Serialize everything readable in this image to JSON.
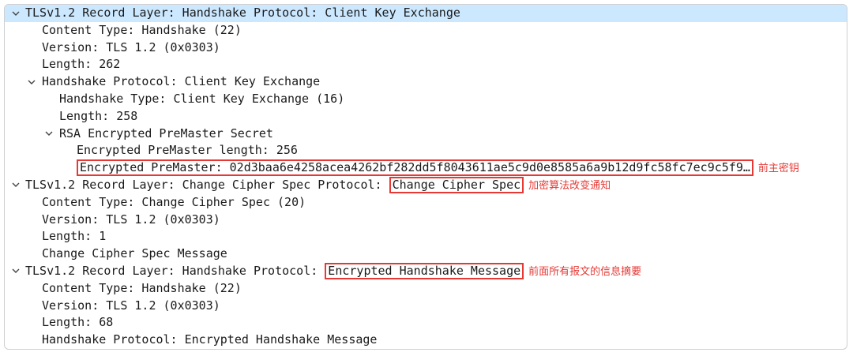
{
  "tree": {
    "rows": [
      {
        "text": "TLSv1.2 Record Layer: Handshake Protocol: Client Key Exchange"
      },
      {
        "text": "Content Type: Handshake (22)"
      },
      {
        "text": "Version: TLS 1.2 (0x0303)"
      },
      {
        "text": "Length: 262"
      },
      {
        "text": "Handshake Protocol: Client Key Exchange"
      },
      {
        "text": "Handshake Type: Client Key Exchange (16)"
      },
      {
        "text": "Length: 258"
      },
      {
        "text": "RSA Encrypted PreMaster Secret"
      },
      {
        "text": "Encrypted PreMaster length: 256"
      },
      {
        "text": "Encrypted PreMaster: 02d3baa6e4258acea4262bf282dd5f8043611ae5c9d0e8585a6a9b12d9fc58fc7ec9c5f9…",
        "note": "前主密钥"
      },
      {
        "prefix": "TLSv1.2 Record Layer: Change Cipher Spec Protocol: ",
        "boxed": "Change Cipher Spec",
        "note": "加密算法改变通知"
      },
      {
        "text": "Content Type: Change Cipher Spec (20)"
      },
      {
        "text": "Version: TLS 1.2 (0x0303)"
      },
      {
        "text": "Length: 1"
      },
      {
        "text": "Change Cipher Spec Message"
      },
      {
        "prefix": "TLSv1.2 Record Layer: Handshake Protocol: ",
        "boxed": "Encrypted Handshake Message",
        "note": "前面所有报文的信息摘要"
      },
      {
        "text": "Content Type: Handshake (22)"
      },
      {
        "text": "Version: TLS 1.2 (0x0303)"
      },
      {
        "text": "Length: 68"
      },
      {
        "text": "Handshake Protocol: Encrypted Handshake Message"
      }
    ]
  },
  "colors": {
    "selected_row": "#cce8ff",
    "annotation": "#e53935"
  },
  "icons": {
    "expanded": "chevron-down-icon"
  }
}
